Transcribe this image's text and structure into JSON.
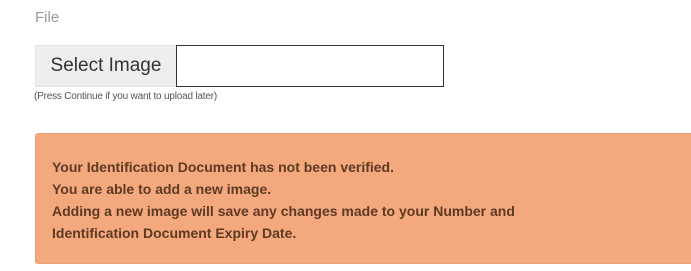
{
  "file_section": {
    "label": "File",
    "select_button_label": "Select Image",
    "file_name_value": "",
    "helper_text": "(Press Continue if you want to upload later)"
  },
  "alert": {
    "lines": [
      "Your Identification Document has not been verified.",
      "You are able to add a new image.",
      "Adding a new image will save any changes made to your Number and",
      "Identification Document Expiry Date."
    ],
    "background_color": "#f4a87d",
    "text_color": "#5d3a22"
  }
}
